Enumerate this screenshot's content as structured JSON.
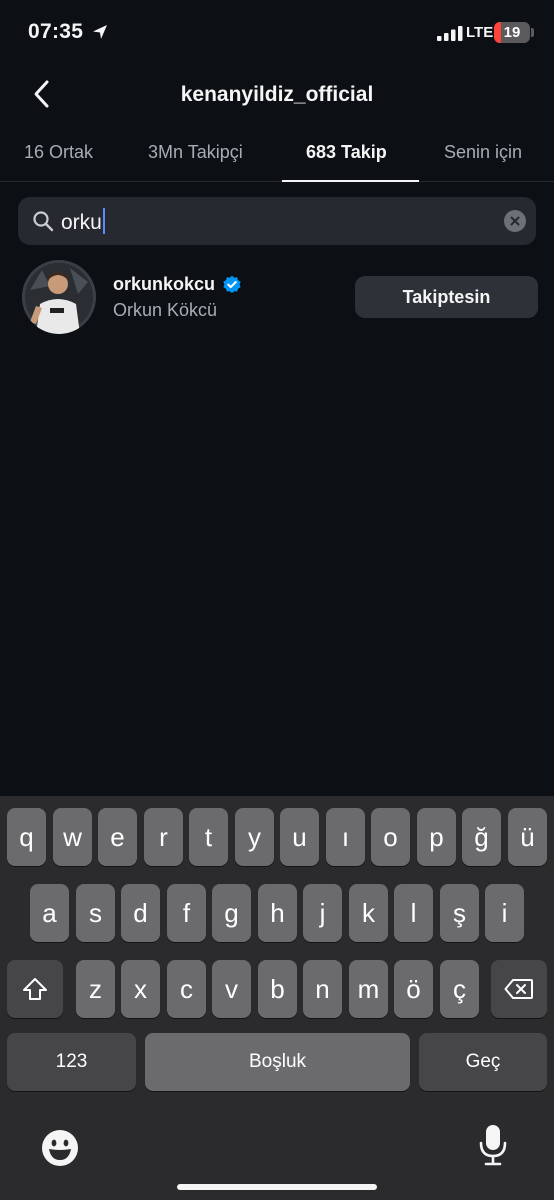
{
  "status_bar": {
    "time": "07:35",
    "network": "LTE",
    "battery": "19",
    "battery_level_percent": 19,
    "signal_bars": 4
  },
  "header": {
    "title": "kenanyildiz_official",
    "back_icon": "chevron-left-icon"
  },
  "tabs": [
    {
      "label": "16 Ortak",
      "active": false
    },
    {
      "label": "3Mn Takipçi",
      "active": false
    },
    {
      "label": "683 Takip",
      "active": true
    },
    {
      "label": "Senin için",
      "active": false
    }
  ],
  "search": {
    "value": "orku",
    "icon": "search-icon",
    "clear_icon": "clear-icon"
  },
  "results": [
    {
      "username": "orkunkokcu",
      "full_name": "Orkun Kökcü",
      "verified": true,
      "button_label": "Takiptesin"
    }
  ],
  "keyboard": {
    "row1": [
      "q",
      "w",
      "e",
      "r",
      "t",
      "y",
      "u",
      "ı",
      "o",
      "p",
      "ğ",
      "ü"
    ],
    "row2": [
      "a",
      "s",
      "d",
      "f",
      "g",
      "h",
      "j",
      "k",
      "l",
      "ş",
      "i"
    ],
    "row3": [
      "z",
      "x",
      "c",
      "v",
      "b",
      "n",
      "m",
      "ö",
      "ç"
    ],
    "numbers_label": "123",
    "space_label": "Boşluk",
    "return_label": "Geç",
    "shift_icon": "shift-icon",
    "delete_icon": "backspace-icon",
    "emoji_icon": "emoji-icon",
    "mic_icon": "microphone-icon"
  },
  "colors": {
    "background": "#0c1014",
    "verified_blue": "#0095f6",
    "battery_low": "#ff453a"
  }
}
